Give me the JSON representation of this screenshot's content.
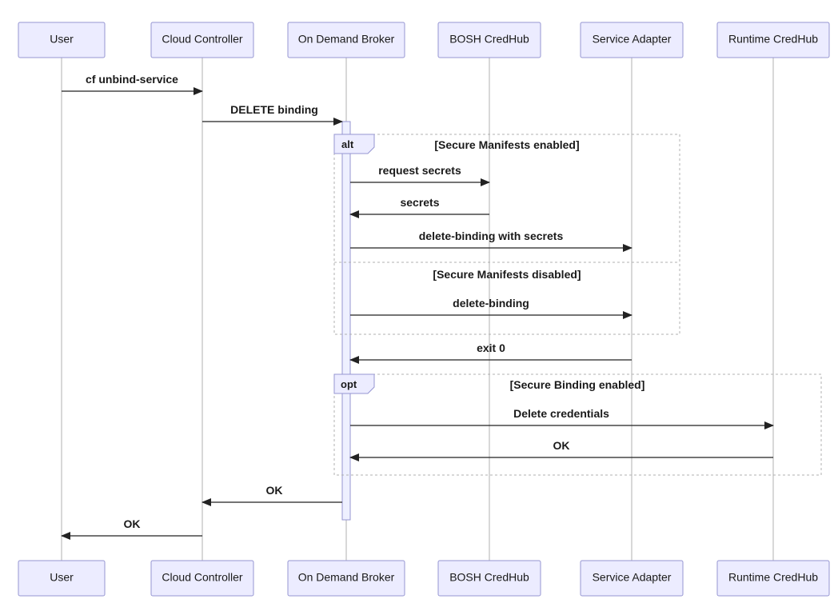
{
  "actors": {
    "user": "User",
    "cc": "Cloud Controller",
    "odb": "On Demand Broker",
    "bosh": "BOSH CredHub",
    "adapter": "Service Adapter",
    "runtime": "Runtime CredHub"
  },
  "messages": {
    "m1": "cf unbind-service",
    "m2": "DELETE binding",
    "m3": "request secrets",
    "m4": "secrets",
    "m5": "delete-binding with secrets",
    "m6": "delete-binding",
    "m7": "exit 0",
    "m8": "Delete credentials",
    "m9": "OK",
    "m10": "OK",
    "m11": "OK"
  },
  "fragments": {
    "alt_label": "alt",
    "alt_guard1": "[Secure Manifests enabled]",
    "alt_guard2": "[Secure Manifests disabled]",
    "opt_label": "opt",
    "opt_guard": "[Secure Binding enabled]"
  }
}
